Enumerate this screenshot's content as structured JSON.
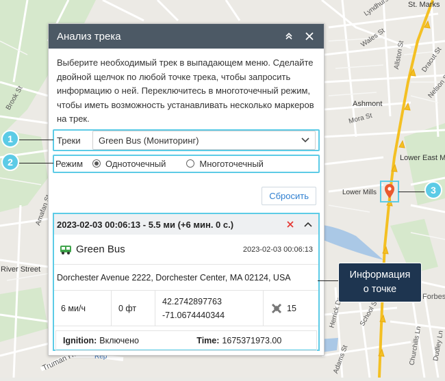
{
  "map": {
    "street_labels": [
      "St. Marks",
      "Lyndhurst St",
      "Wales St",
      "Allston St",
      "Dracut St",
      "Nelson St",
      "Ashmont",
      "Mora St",
      "Brook St",
      "Lower East Mill",
      "Lower Mills",
      "River Street",
      "Amafan St",
      "Truman Hwy",
      "Forbes",
      "Herrick Dr",
      "School St",
      "Churchills Ln",
      "Dudley Ln",
      "Adams St",
      "Rep"
    ]
  },
  "panel": {
    "title": "Анализ трека",
    "description": "Выберите необходимый трек в выпадающем меню. Сделайте двойной щелчок по любой точке трека, чтобы запросить информацию о ней. Переключитесь в многоточечный режим, чтобы иметь возможность устанавливать несколько маркеров на трек.",
    "tracks_label": "Треки",
    "track_selected": "Green Bus (Мониторинг)",
    "mode_label": "Режим",
    "mode_single": "Одноточечный",
    "mode_multi": "Многоточечный",
    "reset_label": "Сбросить"
  },
  "point": {
    "header": "2023-02-03 00:06:13 - 5.5 ми (+6 мин. 0 с.)",
    "unit_name": "Green Bus",
    "unit_time": "2023-02-03 00:06:13",
    "address": "Dorchester Avenue 2222, Dorchester Center, MA 02124, USA",
    "speed": "6 ми/ч",
    "altitude": "0 фт",
    "lat": "42.2742897763",
    "lon": "-71.0674440344",
    "satellites": "15",
    "ignition_label": "Ignition:",
    "ignition_value": "Включено",
    "time_label": "Time:",
    "time_value": "1675371973.00"
  },
  "callouts": {
    "c1": "1",
    "c2": "2",
    "c3": "3"
  },
  "tooltip": {
    "line1": "Информация",
    "line2": "о точке"
  },
  "colors": {
    "header_bg": "#4c5965",
    "accent": "#5ccbe6",
    "track": "#f4c023",
    "marker": "#ea5a2f",
    "link": "#2f7fd0"
  }
}
